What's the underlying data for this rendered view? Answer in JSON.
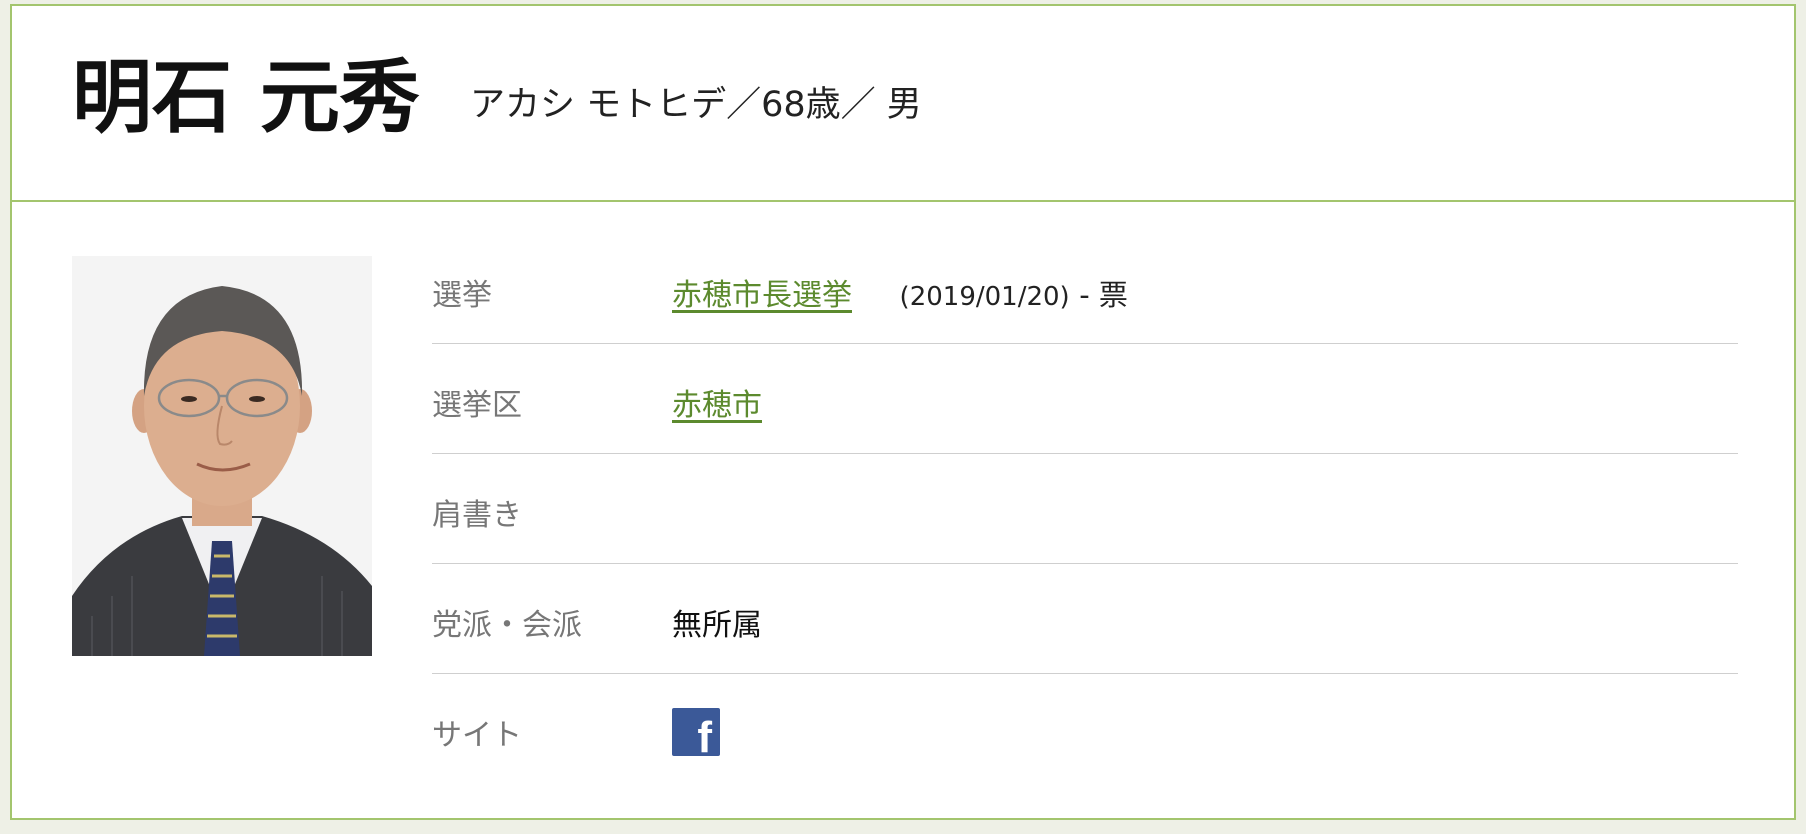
{
  "candidate": {
    "name": "明石 元秀",
    "info": "アカシ モトヒデ／68歳／ 男"
  },
  "details": {
    "election": {
      "label": "選挙",
      "link_text": "赤穂市長選挙",
      "date": "(2019/01/20)",
      "votes": "- 票"
    },
    "district": {
      "label": "選挙区",
      "link_text": "赤穂市"
    },
    "title": {
      "label": "肩書き",
      "value": ""
    },
    "party": {
      "label": "党派・会派",
      "value": "無所属"
    },
    "site": {
      "label": "サイト",
      "icon": "facebook-icon"
    }
  },
  "colors": {
    "border": "#a3c56e",
    "link": "#5c8a2e",
    "facebook": "#3b5998"
  }
}
